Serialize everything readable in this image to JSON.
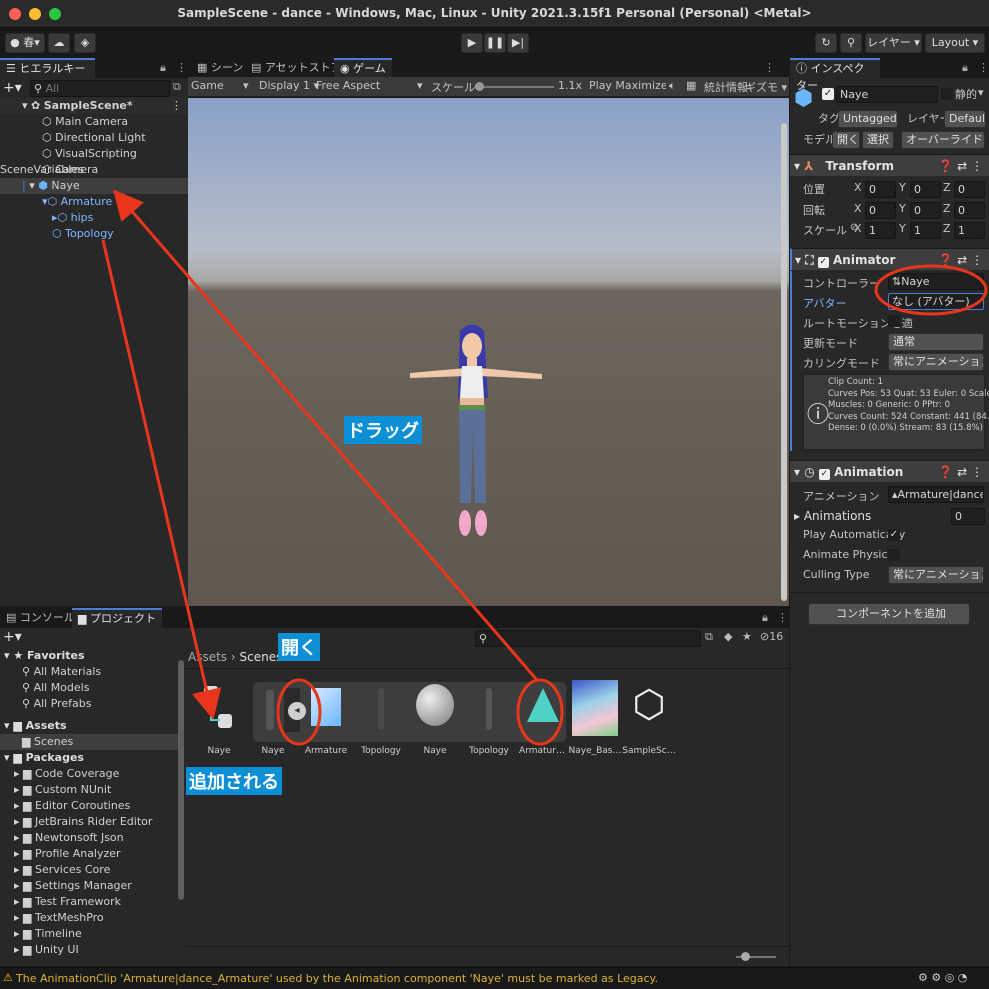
{
  "window": {
    "title": "SampleScene - dance - Windows, Mac, Linux - Unity 2021.3.15f1 Personal (Personal) <Metal>"
  },
  "toolbar": {
    "account_label": "春",
    "layer_label": "レイヤー",
    "layout_label": "Layout"
  },
  "hierarchy": {
    "tab_label": "ヒエラルキー",
    "search_placeholder": "All",
    "items": [
      {
        "label": "SampleScene*"
      },
      {
        "label": "Main Camera"
      },
      {
        "label": "Directional Light"
      },
      {
        "label": "VisualScripting SceneVariables"
      },
      {
        "label": "Camera"
      },
      {
        "label": "Naye"
      },
      {
        "label": "Armature"
      },
      {
        "label": "hips"
      },
      {
        "label": "Topology"
      }
    ]
  },
  "center_tabs": [
    {
      "label": "シーン"
    },
    {
      "label": "アセットストア"
    },
    {
      "label": "ゲーム"
    }
  ],
  "gamebar": {
    "mode": "Game",
    "display": "Display 1",
    "aspect": "Free Aspect",
    "scale_label": "スケール",
    "scale_value": "1.1x",
    "play_mode": "Play Maximized",
    "stats": "統計情報",
    "gizmos": "ギズモ"
  },
  "inspector": {
    "tab_label": "インスペクター",
    "object_name": "Naye",
    "static_label": "静的",
    "tag_label": "タグ",
    "tag_value": "Untagged",
    "layer_label": "レイヤー",
    "layer_value": "Default",
    "model_label": "モデル",
    "open_label": "開く",
    "select_label": "選択",
    "overrides_label": "オーバーライド",
    "transform": {
      "title": "Transform",
      "position_label": "位置",
      "rotation_label": "回転",
      "scale_label": "スケール",
      "position": [
        "0",
        "0",
        "0"
      ],
      "rotation": [
        "0",
        "0",
        "0"
      ],
      "scale": [
        "1",
        "1",
        "1"
      ],
      "axes": [
        "X",
        "Y",
        "Z"
      ]
    },
    "animator": {
      "title": "Animator",
      "controller_label": "コントローラー",
      "controller_value": "Naye",
      "avatar_label": "アバター",
      "avatar_value": "なし (アバター)",
      "root_motion_label": "ルートモーションを適",
      "update_mode_label": "更新モード",
      "update_mode_value": "通常",
      "culling_label": "カリングモード",
      "culling_value": "常にアニメーション化",
      "info_lines": [
        "Clip Count: 1",
        "Curves Pos: 53 Quat: 53 Euler: 0 Scale: 51",
        "Muscles: 0 Generic: 0 PPtr: 0",
        "Curves Count: 524 Constant: 441 (84.2%)",
        "Dense: 0 (0.0%) Stream: 83 (15.8%)"
      ]
    },
    "animation": {
      "title": "Animation",
      "animation_label": "アニメーション",
      "animation_value": "Armature|dance_",
      "animations_label": "Animations",
      "animations_count": "0",
      "play_auto_label": "Play Automatically",
      "animate_physics_label": "Animate Physics",
      "culling_type_label": "Culling Type",
      "culling_type_value": "常にアニメーション化"
    },
    "add_component_label": "コンポーネントを追加"
  },
  "bottom_tabs": [
    {
      "label": "コンソール"
    },
    {
      "label": "プロジェクト"
    }
  ],
  "project": {
    "hidden_count": "16",
    "breadcrumb_root": "Assets",
    "breadcrumb_leaf": "Scenes",
    "favorites_label": "Favorites",
    "favorites": [
      "All Materials",
      "All Models",
      "All Prefabs"
    ],
    "assets_label": "Assets",
    "assets_children": [
      "Scenes"
    ],
    "packages_label": "Packages",
    "packages": [
      "Code Coverage",
      "Custom NUnit",
      "Editor Coroutines",
      "JetBrains Rider Editor",
      "Newtonsoft Json",
      "Profile Analyzer",
      "Services Core",
      "Settings Manager",
      "Test Framework",
      "TextMeshPro",
      "Timeline",
      "Unity UI"
    ],
    "assets": [
      {
        "label": "Naye"
      },
      {
        "label": "Naye"
      },
      {
        "label": "Armature"
      },
      {
        "label": "Topology"
      },
      {
        "label": "Naye"
      },
      {
        "label": "Topology"
      },
      {
        "label": "Armatur…"
      },
      {
        "label": "Naye_Bas…"
      },
      {
        "label": "SampleSc…"
      }
    ]
  },
  "annotations": {
    "drag": "ドラッグ",
    "open": "開く",
    "added": "追加される",
    "color": "#e8361c"
  },
  "status_bar": {
    "message": "The AnimationClip 'Armature|dance_Armature' used by the Animation component 'Naye' must be marked as Legacy."
  }
}
